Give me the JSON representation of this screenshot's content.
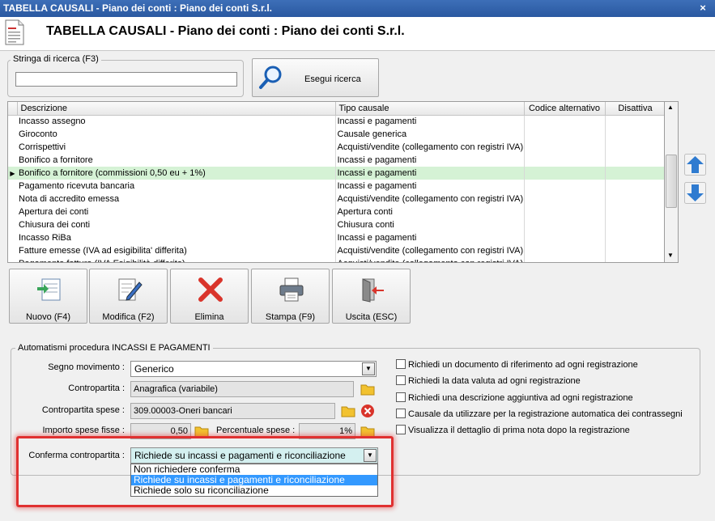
{
  "window": {
    "title": "TABELLA CAUSALI - Piano dei conti : Piano dei conti S.r.l.",
    "close_glyph": "×"
  },
  "header": {
    "title": "TABELLA CAUSALI - Piano dei conti : Piano dei conti S.r.l.",
    "icon": "document-icon"
  },
  "search": {
    "group_label": "Stringa di ricerca (F3)",
    "value": "",
    "button_label": "Esegui ricerca"
  },
  "grid": {
    "columns": [
      "Descrizione",
      "Tipo causale",
      "Codice alternativo",
      "Disattiva"
    ],
    "rows": [
      {
        "descrizione": "Incasso assegno",
        "tipo": "Incassi e pagamenti"
      },
      {
        "descrizione": "Giroconto",
        "tipo": "Causale generica"
      },
      {
        "descrizione": "Corrispettivi",
        "tipo": "Acquisti/vendite (collegamento con registri IVA)"
      },
      {
        "descrizione": "Bonifico a fornitore",
        "tipo": "Incassi e pagamenti"
      },
      {
        "descrizione": "Bonifico a fornitore (commissioni 0,50 eu + 1%)",
        "tipo": "Incassi e pagamenti",
        "selected": true
      },
      {
        "descrizione": "Pagamento ricevuta bancaria",
        "tipo": "Incassi e pagamenti"
      },
      {
        "descrizione": "Nota di accredito emessa",
        "tipo": "Acquisti/vendite (collegamento con registri IVA)"
      },
      {
        "descrizione": "Apertura dei conti",
        "tipo": "Apertura conti"
      },
      {
        "descrizione": "Chiusura dei conti",
        "tipo": "Chiusura conti"
      },
      {
        "descrizione": "Incasso RiBa",
        "tipo": "Incassi e pagamenti"
      },
      {
        "descrizione": "Fatture emesse (IVA ad esigibilita' differita)",
        "tipo": "Acquisti/vendite (collegamento con registri IVA)"
      },
      {
        "descrizione": "Pagamento fattura (IVA Esigibilità differita)",
        "tipo": "Acquisti/vendite (collegamento con registri IVA)"
      }
    ]
  },
  "toolbar": {
    "nuovo": "Nuovo (F4)",
    "modifica": "Modifica (F2)",
    "elimina": "Elimina",
    "stampa": "Stampa (F9)",
    "uscita": "Uscita (ESC)"
  },
  "automatismi": {
    "group_label": "Automatismi procedura INCASSI E PAGAMENTI",
    "segno_label": "Segno movimento :",
    "segno_value": "Generico",
    "contropartita_label": "Contropartita :",
    "contropartita_value": "Anagrafica (variabile)",
    "contropartita_spese_label": "Contropartita spese :",
    "contropartita_spese_value": "309.00003-Oneri bancari",
    "importo_label": "Importo spese fisse :",
    "importo_value": "0,50",
    "percentuale_label": "Percentuale spese :",
    "percentuale_value": "1%",
    "conferma_label": "Conferma contropartita :",
    "conferma_value": "Richiede su incassi e pagamenti e riconciliazione",
    "conferma_options": [
      "Non richiedere conferma",
      "Richiede su incassi e pagamenti e riconciliazione",
      "Richiede solo su riconciliazione"
    ],
    "conferma_highlighted_index": 1,
    "checkboxes": [
      {
        "label": "Richiedi un documento di riferimento ad ogni registrazione",
        "checked": false
      },
      {
        "label": "Richiedi la data valuta ad ogni registrazione",
        "checked": false
      },
      {
        "label": "Richiedi una descrizione aggiuntiva ad ogni registrazione",
        "checked": false
      },
      {
        "label": "Causale da utilizzare per la registrazione automatica dei contrassegni",
        "checked": false
      },
      {
        "label": "Visualizza il dettaglio di prima nota dopo la registrazione",
        "checked": false
      }
    ]
  },
  "colors": {
    "titlebar": "#2f5fa8",
    "selected_row": "#d5f2d5",
    "dropdown_highlight": "#3399ff",
    "callout": "#e03030"
  }
}
